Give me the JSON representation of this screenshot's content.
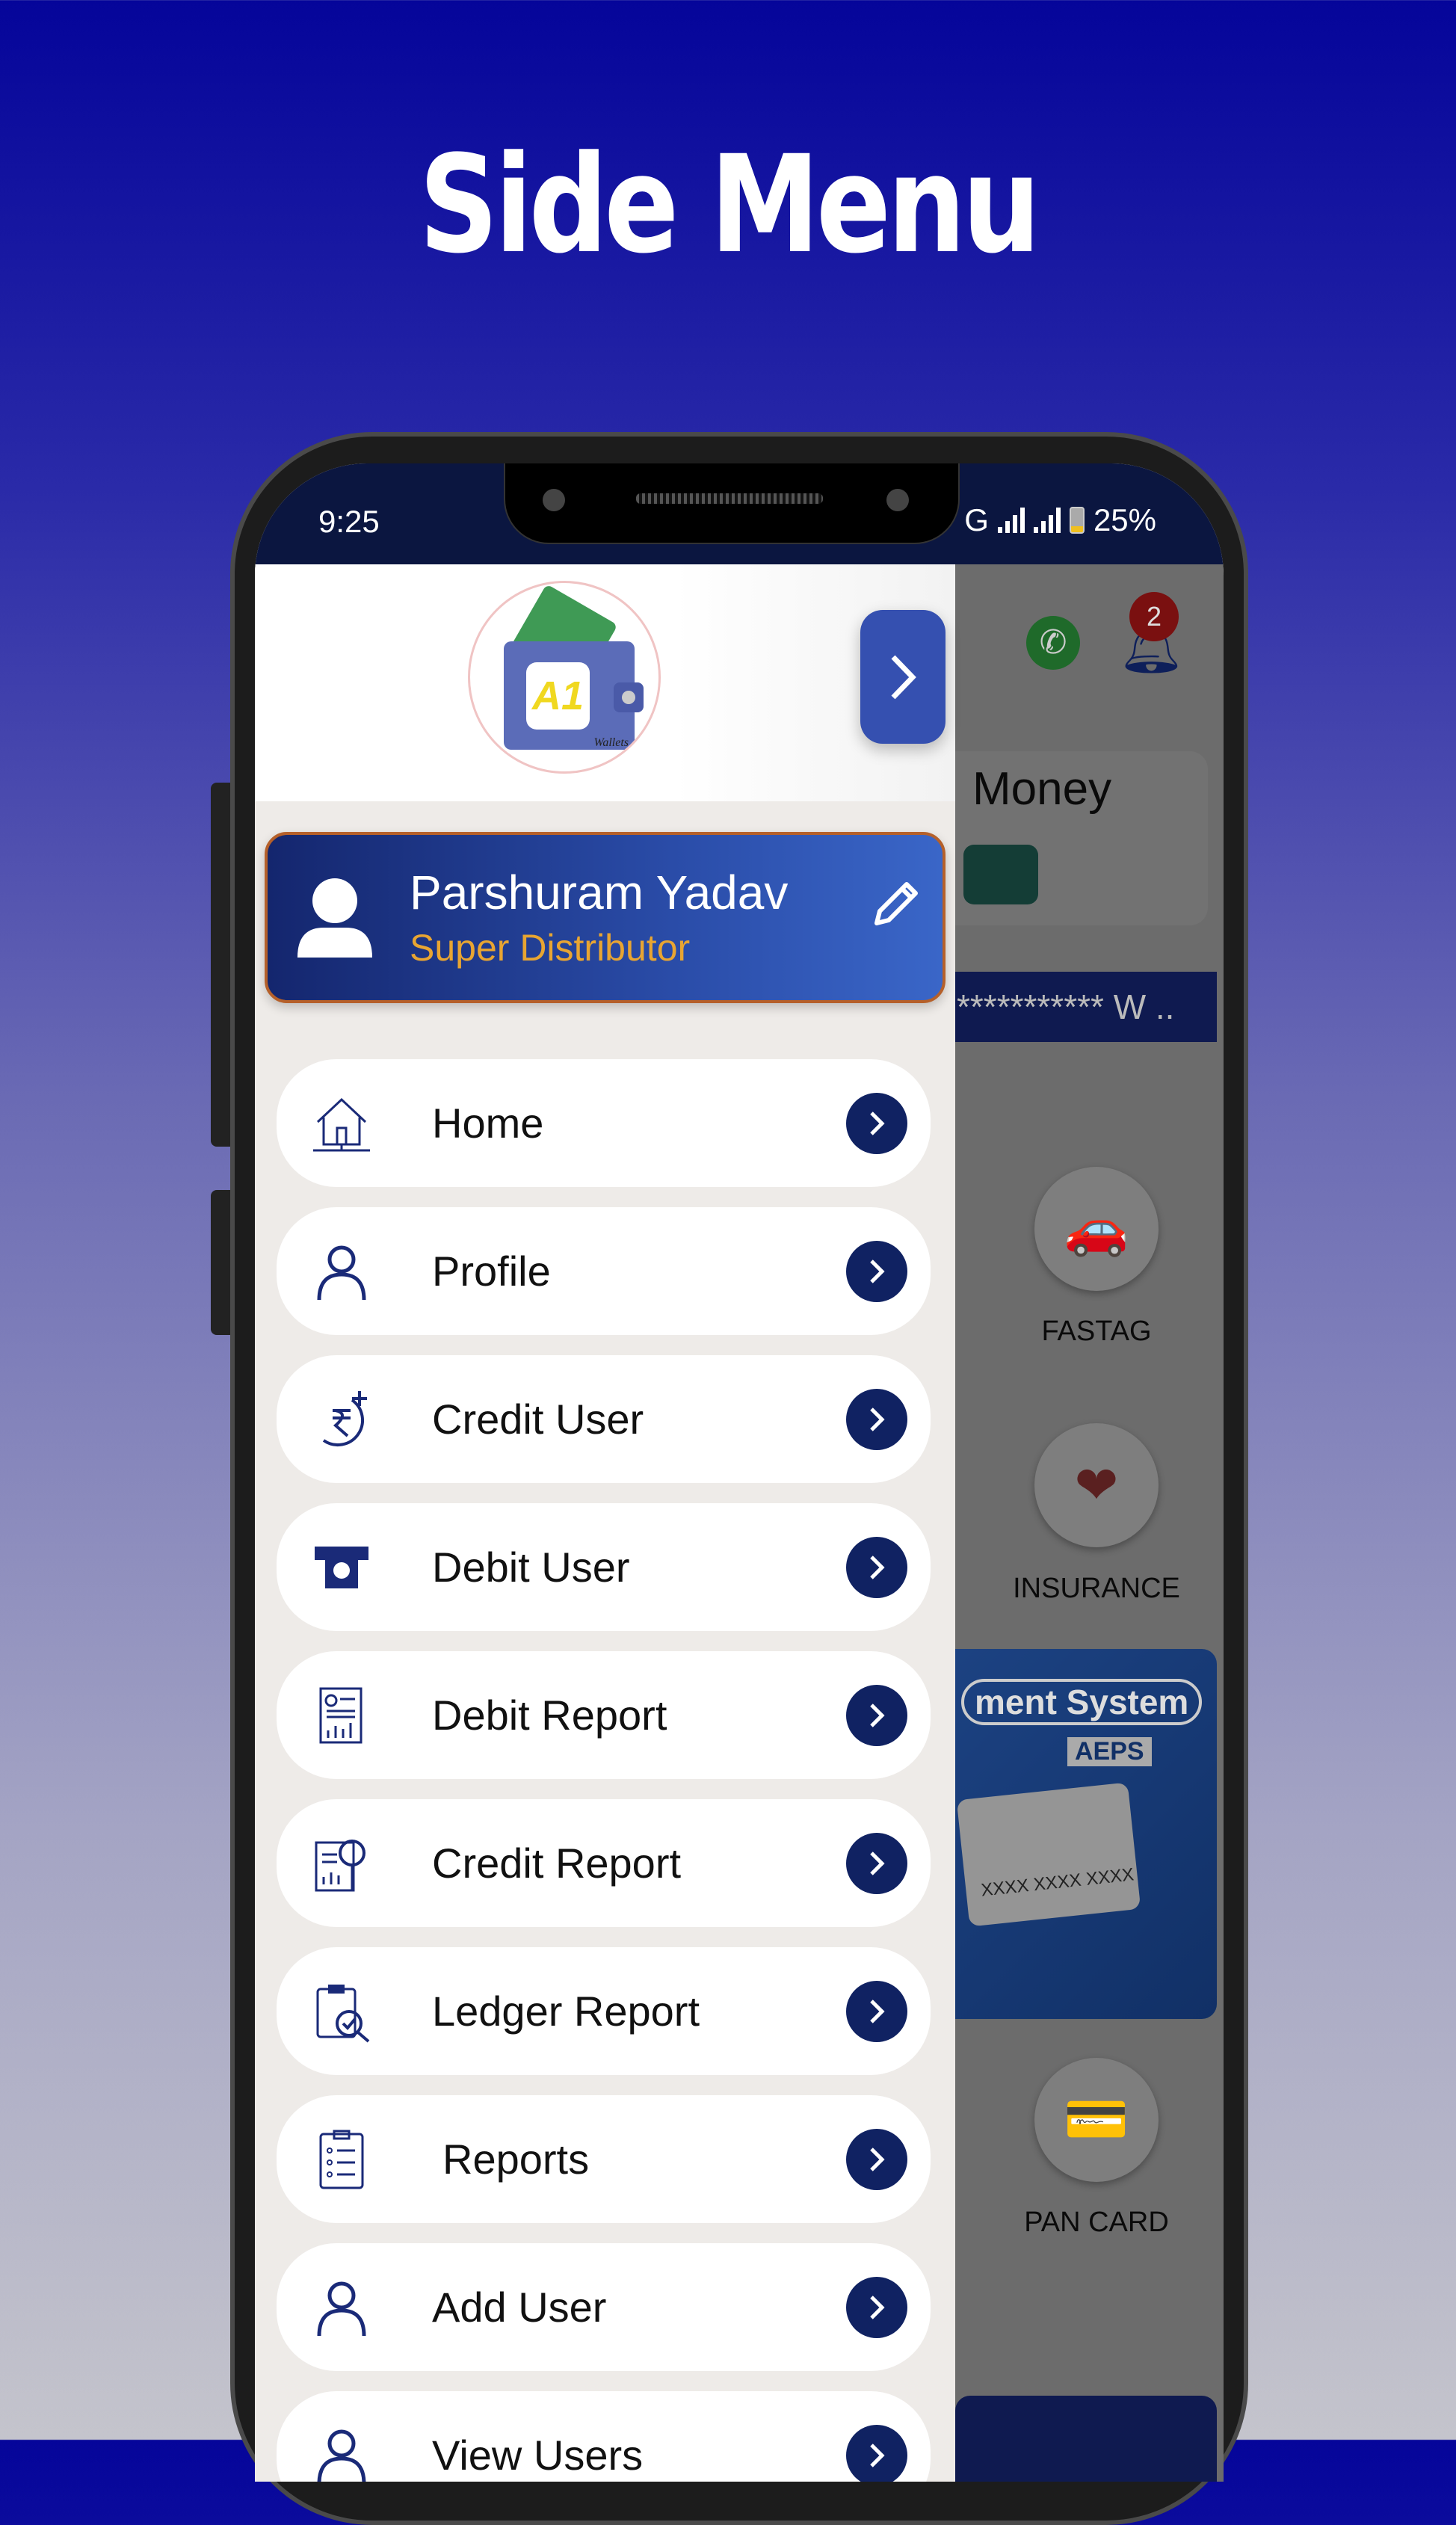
{
  "page_title": "Side Menu",
  "status_bar": {
    "time": "9:25",
    "network": "G",
    "battery": "25%"
  },
  "colors": {
    "accent": "#3550b0",
    "navy": "#102262",
    "role_text": "#e8a532",
    "card_border": "#b5602a",
    "status_bar": "#0b1640"
  },
  "logo": {
    "text": "A1",
    "brand": "Wallets"
  },
  "drawer_toggle": {
    "icon": "chevron-right-icon"
  },
  "profile": {
    "name": "Parshuram Yadav",
    "role": "Super Distributor",
    "edit_icon": "pencil-icon"
  },
  "menu": [
    {
      "label": "Home",
      "icon": "home-icon"
    },
    {
      "label": "Profile",
      "icon": "user-icon"
    },
    {
      "label": "Credit User",
      "icon": "rupee-add-icon"
    },
    {
      "label": "Debit User",
      "icon": "atm-icon"
    },
    {
      "label": "Debit Report",
      "icon": "report-chart-icon"
    },
    {
      "label": "Credit Report",
      "icon": "report-search-icon"
    },
    {
      "label": "Ledger Report",
      "icon": "clipboard-check-icon"
    },
    {
      "label": "Reports",
      "icon": "checklist-icon"
    },
    {
      "label": "Add User",
      "icon": "user-icon"
    },
    {
      "label": "View Users",
      "icon": "user-icon"
    }
  ],
  "background_screen": {
    "notification_count": "2",
    "money_label": "Money",
    "masked_text": "*********** W ..",
    "services": [
      {
        "label": "FASTAG"
      },
      {
        "label": "INSURANCE"
      },
      {
        "label": "PAN CARD"
      }
    ],
    "banner": {
      "title": "ment System",
      "tag": "AEPS",
      "card_text": "XXXX XXXX XXXX"
    }
  }
}
